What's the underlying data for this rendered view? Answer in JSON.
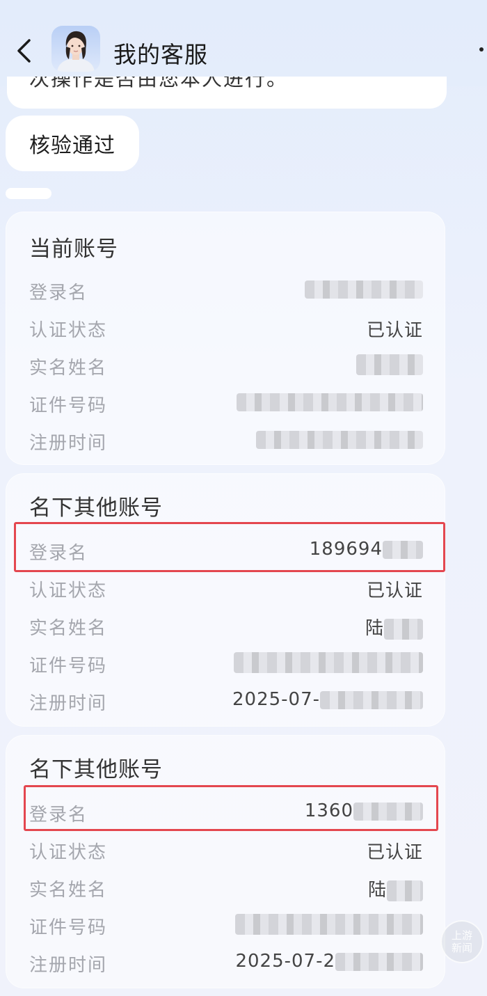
{
  "header": {
    "title": "我的客服"
  },
  "previous_message": {
    "text": "次操作是否由您本人进行。"
  },
  "message": {
    "text": "核验通过"
  },
  "current_account": {
    "title": "当前账号",
    "rows": [
      {
        "label": "登录名",
        "value": ""
      },
      {
        "label": "认证状态",
        "value": "已认证"
      },
      {
        "label": "实名姓名",
        "value": ""
      },
      {
        "label": "证件号码",
        "value": ""
      },
      {
        "label": "注册时间",
        "value": ""
      }
    ]
  },
  "other_account_1": {
    "title": "名下其他账号",
    "rows": [
      {
        "label": "登录名",
        "value": "189694"
      },
      {
        "label": "认证状态",
        "value": "已认证"
      },
      {
        "label": "实名姓名",
        "value": "陆"
      },
      {
        "label": "证件号码",
        "value": ""
      },
      {
        "label": "注册时间",
        "value": "2025-07-"
      }
    ]
  },
  "other_account_2": {
    "title": "名下其他账号",
    "rows": [
      {
        "label": "登录名",
        "value": "1360"
      },
      {
        "label": "认证状态",
        "value": "已认证"
      },
      {
        "label": "实名姓名",
        "value": "陆"
      },
      {
        "label": "证件号码",
        "value": ""
      },
      {
        "label": "注册时间",
        "value": "2025-07-2"
      }
    ]
  },
  "watermark": {
    "text": "上游新闻"
  },
  "colors": {
    "highlight": "#e4474f",
    "label": "#a4a6ad",
    "value": "#444444"
  },
  "icons": {
    "back": "back-arrow-icon",
    "avatar": "assistant-avatar",
    "more": "more-dot-icon"
  }
}
